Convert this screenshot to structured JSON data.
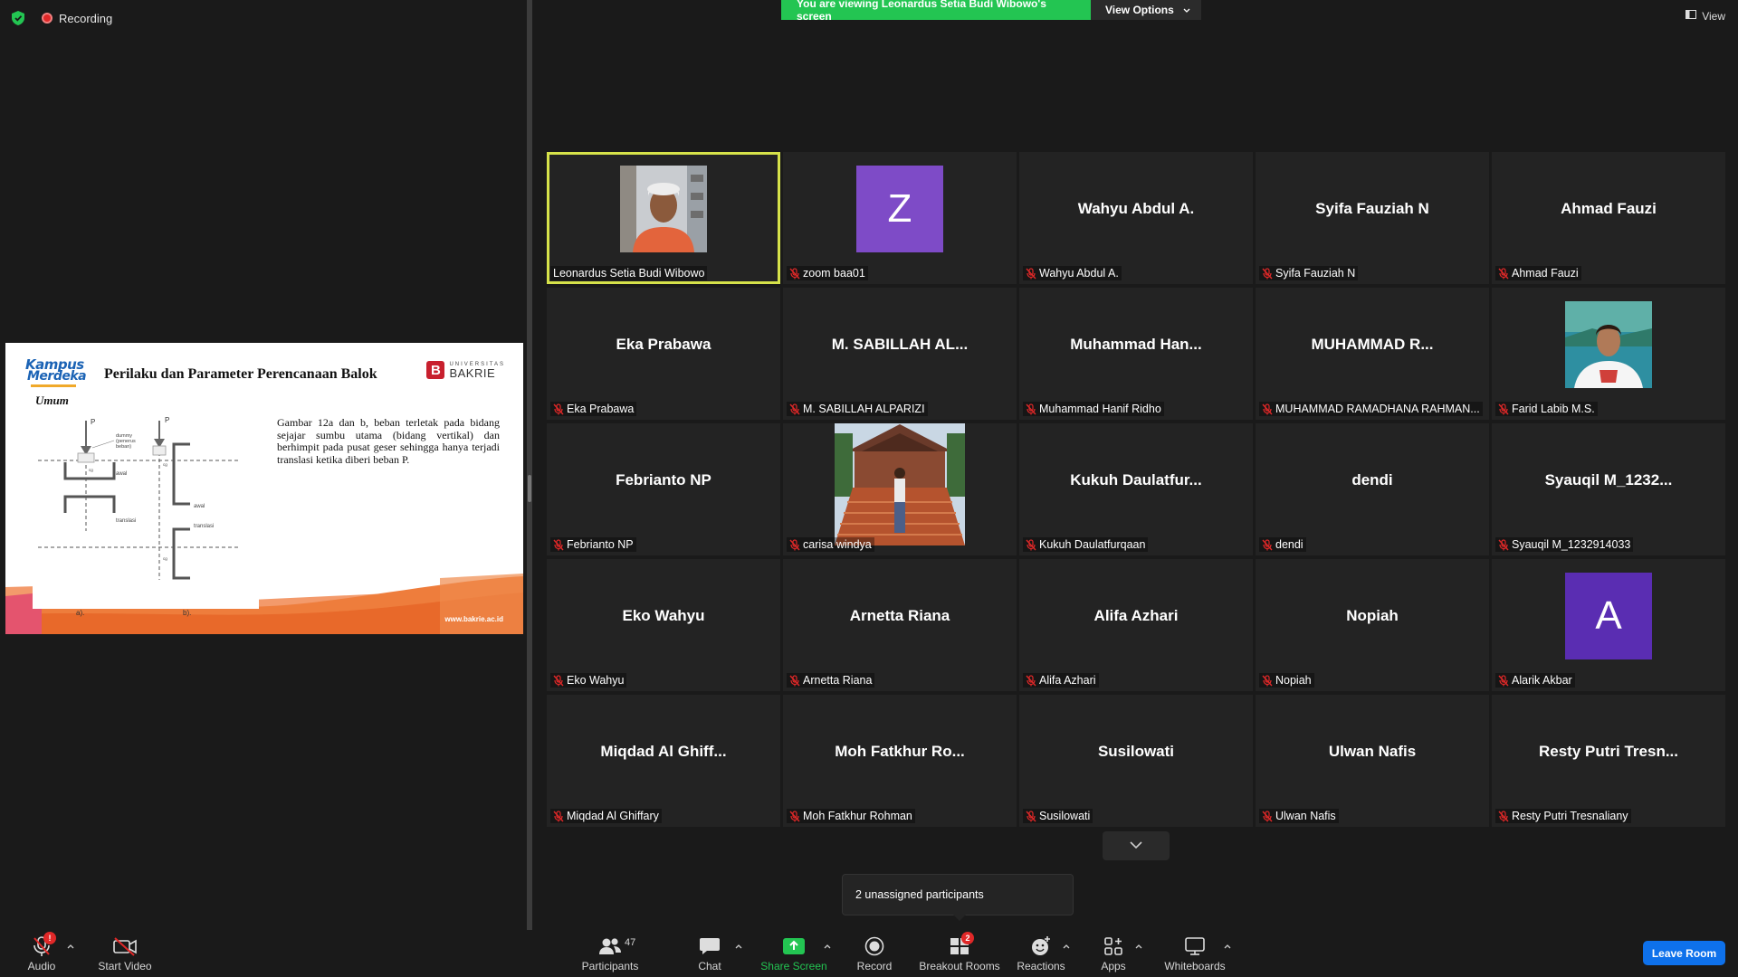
{
  "recording": {
    "label": "Recording"
  },
  "banner": {
    "viewing_text": "You are viewing Leonardus Setia Budi Wibowo's screen",
    "options_label": "View Options"
  },
  "view": {
    "label": "View"
  },
  "slide": {
    "logo_line1": "Kampus",
    "logo_line2": "Merdeka",
    "title": "Perilaku dan Parameter Perencanaan Balok",
    "univ_small": "UNIVERSITAS",
    "univ_big": "BAKRIE",
    "subtitle": "Umum",
    "body": "Gambar 12a dan b, beban terletak pada bidang sejajar sumbu utama (bidang vertikal) dan berhimpit pada pusat geser sehingga hanya terjadi translasi ketika diberi beban P.",
    "url": "www.bakrie.ac.id",
    "fig_a": "a).",
    "fig_b": "b).",
    "diagram_labels": {
      "p": "P",
      "dummy": "dummy",
      "penerus": "(penerus",
      "beban": "beban)",
      "awal": "awal",
      "translasi": "translasi",
      "cg": "cg"
    }
  },
  "participants_tiles": [
    {
      "display": "",
      "label": "Leonardus Setia Budi Wibowo",
      "muted": false,
      "type": "photo-man"
    },
    {
      "display": "Z",
      "label": "zoom baa01",
      "muted": true,
      "type": "letter",
      "color": "#7e4bc7"
    },
    {
      "display": "Wahyu Abdul A.",
      "label": "Wahyu Abdul A.",
      "muted": true,
      "type": "name"
    },
    {
      "display": "Syifa Fauziah N",
      "label": "Syifa Fauziah N",
      "muted": true,
      "type": "name"
    },
    {
      "display": "Ahmad Fauzi",
      "label": "Ahmad Fauzi",
      "muted": true,
      "type": "name"
    },
    {
      "display": "Eka Prabawa",
      "label": "Eka Prabawa",
      "muted": true,
      "type": "name"
    },
    {
      "display": "M. SABILLAH AL...",
      "label": "M. SABILLAH ALPARIZI",
      "muted": true,
      "type": "name"
    },
    {
      "display": "Muhammad Han...",
      "label": "Muhammad Hanif Ridho",
      "muted": true,
      "type": "name"
    },
    {
      "display": "MUHAMMAD R...",
      "label": "MUHAMMAD RAMADHANA RAHMAN...",
      "muted": true,
      "type": "name"
    },
    {
      "display": "",
      "label": "Farid Labib M.S.",
      "muted": true,
      "type": "photo-farid"
    },
    {
      "display": "Febrianto NP",
      "label": "Febrianto NP",
      "muted": true,
      "type": "name"
    },
    {
      "display": "",
      "label": "carisa windya",
      "muted": true,
      "type": "photo-carisa"
    },
    {
      "display": "Kukuh Daulatfur...",
      "label": "Kukuh Daulatfurqaan",
      "muted": true,
      "type": "name"
    },
    {
      "display": "dendi",
      "label": "dendi",
      "muted": true,
      "type": "name"
    },
    {
      "display": "Syauqil M_1232...",
      "label": "Syauqil M_1232914033",
      "muted": true,
      "type": "name"
    },
    {
      "display": "Eko Wahyu",
      "label": "Eko Wahyu",
      "muted": true,
      "type": "name"
    },
    {
      "display": "Arnetta Riana",
      "label": "Arnetta Riana",
      "muted": true,
      "type": "name"
    },
    {
      "display": "Alifa Azhari",
      "label": "Alifa Azhari",
      "muted": true,
      "type": "name"
    },
    {
      "display": "Nopiah",
      "label": "Nopiah",
      "muted": true,
      "type": "name"
    },
    {
      "display": "A",
      "label": "Alarik Akbar",
      "muted": true,
      "type": "letter",
      "color": "#5a2db2"
    },
    {
      "display": "Miqdad Al Ghiff...",
      "label": "Miqdad Al Ghiffary",
      "muted": true,
      "type": "name"
    },
    {
      "display": "Moh Fatkhur Ro...",
      "label": "Moh Fatkhur Rohman",
      "muted": true,
      "type": "name"
    },
    {
      "display": "Susilowati",
      "label": "Susilowati",
      "muted": true,
      "type": "name"
    },
    {
      "display": "Ulwan Nafis",
      "label": "Ulwan Nafis",
      "muted": true,
      "type": "name"
    },
    {
      "display": "Resty Putri Tresn...",
      "label": "Resty Putri Tresnaliany",
      "muted": true,
      "type": "name"
    }
  ],
  "tooltip": {
    "text": "2 unassigned participants"
  },
  "toolbar": {
    "audio": "Audio",
    "audio_badge": "!",
    "start_video": "Start Video",
    "participants": "Participants",
    "participants_count": "47",
    "chat": "Chat",
    "share_screen": "Share Screen",
    "record": "Record",
    "breakout_rooms": "Breakout Rooms",
    "breakout_badge": "2",
    "reactions": "Reactions",
    "apps": "Apps",
    "whiteboards": "Whiteboards",
    "leave_room": "Leave Room"
  },
  "colors": {
    "active_speaker": "#d6e24a",
    "green": "#23c552",
    "leave": "#0e71eb",
    "muted_red": "#e02828"
  }
}
